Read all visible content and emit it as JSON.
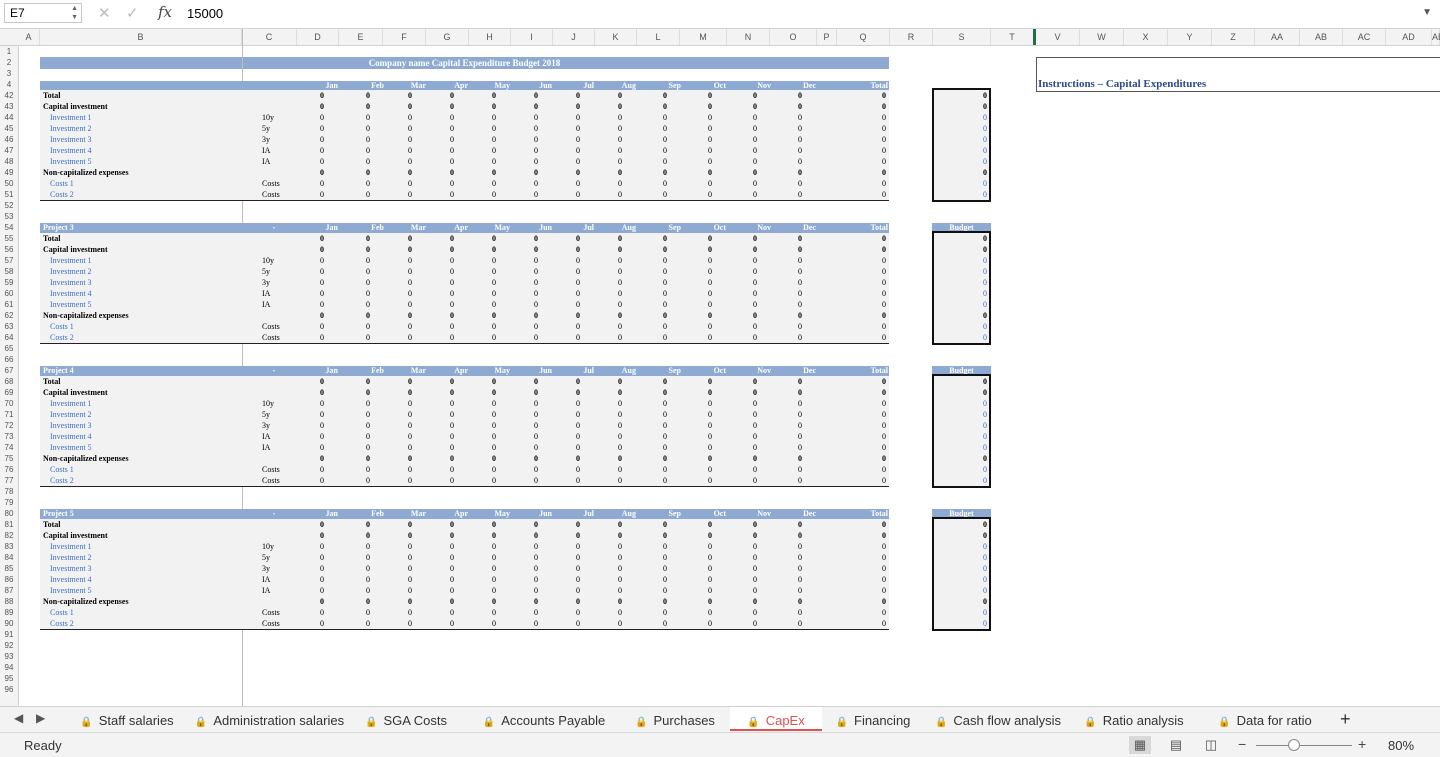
{
  "formula_bar": {
    "name_box": "E7",
    "formula_value": "15000"
  },
  "columns": [
    "A",
    "B",
    "C",
    "D",
    "E",
    "F",
    "G",
    "H",
    "I",
    "J",
    "K",
    "L",
    "M",
    "N",
    "O",
    "P",
    "Q",
    "R",
    "S",
    "T",
    "V",
    "W",
    "X",
    "Y",
    "Z",
    "AA",
    "AB",
    "AC",
    "AD",
    "AE"
  ],
  "rows": [
    "1",
    "2",
    "3",
    "4",
    "42",
    "43",
    "44",
    "45",
    "46",
    "47",
    "48",
    "49",
    "50",
    "51",
    "52",
    "53",
    "54",
    "55",
    "56",
    "57",
    "58",
    "59",
    "60",
    "61",
    "62",
    "63",
    "64",
    "65",
    "66",
    "67",
    "68",
    "69",
    "70",
    "71",
    "72",
    "73",
    "74",
    "75",
    "76",
    "77",
    "78",
    "79",
    "80",
    "81",
    "82",
    "83",
    "84",
    "85",
    "86",
    "87",
    "88",
    "89",
    "90",
    "91",
    "92",
    "93",
    "94",
    "95",
    "96"
  ],
  "sheet_title": "Company name Capital Expenditure Budget 2018",
  "instructions_title": "Instructions – Capital Expenditures",
  "months": [
    "Jan",
    "Feb",
    "Mar",
    "Apr",
    "May",
    "Jun",
    "Jul",
    "Aug",
    "Sep",
    "Oct",
    "Nov",
    "Dec",
    "Total"
  ],
  "budget_label": "Budget",
  "dash": "-",
  "row_labels": {
    "total": "Total",
    "capital_investment": "Capital investment",
    "investments": [
      "Investment 1",
      "Investment 2",
      "Investment 3",
      "Investment 4",
      "Investment 5"
    ],
    "investment_codes": [
      "10y",
      "5y",
      "3y",
      "IA",
      "IA"
    ],
    "noncap": "Non-capitalized expenses",
    "costs": [
      "Costs 1",
      "Costs 2"
    ],
    "cost_codes": [
      "Costs",
      "Costs"
    ]
  },
  "zero": "0",
  "projects": [
    {
      "name": "",
      "has_header": false
    },
    {
      "name": "Project 3",
      "has_header": true
    },
    {
      "name": "Project 4",
      "has_header": true
    },
    {
      "name": "Project 5",
      "has_header": true
    }
  ],
  "sheet_tabs": [
    "Staff salaries",
    "Administration salaries",
    "SGA Costs",
    "Accounts Payable",
    "Purchases",
    "CapEx",
    "Financing",
    "Cash flow analysis",
    "Ratio analysis",
    "Data for ratio"
  ],
  "active_tab": "CapEx",
  "status": {
    "ready": "Ready",
    "zoom": "80%"
  }
}
